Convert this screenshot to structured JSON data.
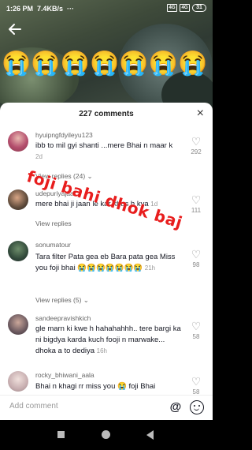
{
  "status_bar": {
    "time": "1:26 PM",
    "speed": "7.4KB/s",
    "more": "···",
    "signal1": "4G",
    "signal2": "4G",
    "battery": "31"
  },
  "video": {
    "emoji_row": "😭😭😭😭😭😭😭"
  },
  "sheet": {
    "title": "227 comments",
    "close_icon": "×"
  },
  "comments": [
    {
      "user": "hyuipngfdyileyu123",
      "text": "ibb to mil gyi shanti ...mere Bhai n maar k",
      "time": "2d",
      "likes": "292",
      "replies": "View replies (24)"
    },
    {
      "user": "udepuriyajaat",
      "text": "mere bhai ji jaan le kar khus h kya",
      "time": "1d",
      "likes": "111",
      "replies": "View replies"
    },
    {
      "user": "sonumatour",
      "text": "Tara filter Pata gea eb Bara pata gea Miss you foji bhai 😭😭😭😭😭😭😭",
      "time": "21h",
      "likes": "98",
      "replies": "View replies (5)"
    },
    {
      "user": "sandeepravishkich",
      "text": "gle marn ki kwe h hahahahhh.. tere bargi ka ni bigdya karda kuch fooji n marwake... dhoka a to dediya",
      "time": "16h",
      "likes": "58",
      "replies": ""
    },
    {
      "user": "rocky_bhiwani_aala",
      "text": "Bhai n khagi rr miss you 😭 foji Bhai",
      "time": "",
      "likes": "58",
      "replies": ""
    }
  ],
  "overlay": {
    "text": "foji bahi dhok baj"
  },
  "add_comment": {
    "placeholder": "Add comment",
    "at_icon": "@"
  },
  "colors": {
    "overlay_red": "#e81d1d",
    "sheet_bg": "#ffffff",
    "text_primary": "#161823"
  }
}
